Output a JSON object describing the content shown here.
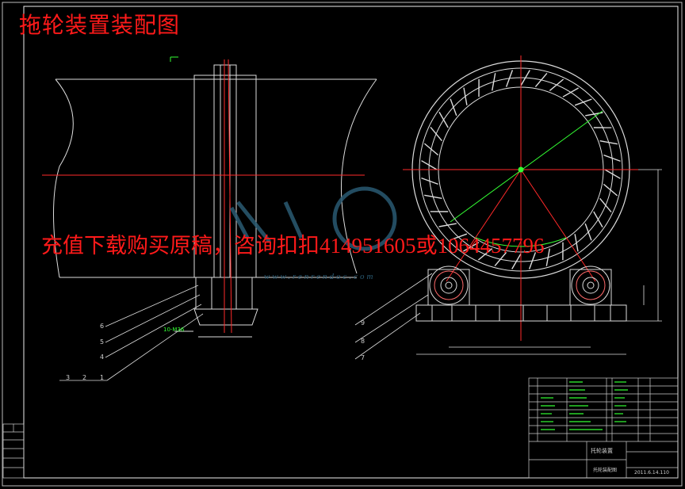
{
  "drawing": {
    "title": "拖轮装置装配图",
    "overlay_text": "充值下载购买原稿，咨询扣扣414951605或1064457796",
    "watermark_url": "www.renrendoc.com"
  },
  "callouts": {
    "left": [
      "6",
      "5",
      "4",
      "3",
      "2",
      "1"
    ],
    "right": [
      "9",
      "8",
      "7"
    ],
    "bolt_spec": "10-M36"
  },
  "title_block": {
    "assembly_name": "托轮装置",
    "drawing_name": "托轮装配图",
    "date": "2011.6.14.110"
  }
}
